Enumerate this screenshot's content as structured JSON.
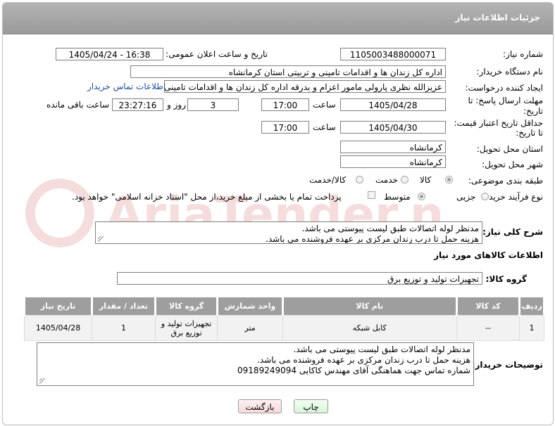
{
  "header": {
    "title": "جزئیات اطلاعات نیاز"
  },
  "form": {
    "need_number_label": "شماره نیاز:",
    "need_number": "1105003488000071",
    "announce_label": "تاریخ و ساعت اعلان عمومی:",
    "announce_value": "1405/04/24 - 16:38",
    "buyer_org_label": "نام دستگاه خریدار:",
    "buyer_org": "اداره کل زندان ها و اقدامات تامینی و تربیتی استان کرمانشاه",
    "requester_label": "ایجاد کننده درخواست:",
    "requester": "عزیزالله نظری پارولی مامور اعزام و بدرقه اداره کل زندان ها و اقدامات تامینی و تربیتی استان کرمانشاه",
    "contact_link": "اطلاعات تماس خریدار",
    "deadline_label": "مهلت ارسال پاسخ: تا تاریخ:",
    "deadline_label_1": "مهلت ارسال پاسخ: تا",
    "deadline_label_2": "تاریخ:",
    "deadline_date": "1405/04/28",
    "time_label": "ساعت",
    "deadline_time": "17:00",
    "days_value": "3",
    "days_label": "روز و",
    "remaining_time": "23:27:16",
    "remaining_label": "ساعت باقی مانده",
    "validity_label_1": "حداقل تاریخ اعتبار قیمت:",
    "validity_label_2": "تا تاریخ:",
    "validity_date": "1405/04/30",
    "validity_time": "17:00",
    "province_label": "استان محل تحویل:",
    "province": "کرمانشاه",
    "city_label": "شهر محل تحویل:",
    "city": "کرمانشاه",
    "category_label": "طبقه بندی موضوعی:",
    "category_options": [
      "کالا",
      "خدمت",
      "کالا/خدمت"
    ],
    "process_label": "نوع فرآیند خرید :",
    "process_options": [
      "جزیی",
      "متوسط"
    ],
    "payment_text": "پرداخت تمام یا بخشی از مبلغ خرید،از محل \"اسناد خزانه اسلامی\" خواهد بود."
  },
  "summary": {
    "label": "شرح کلی نیاز:",
    "lines": [
      "مدنظر لوله اتصالات طبق لیست پیوستی  می باشد.",
      "هزینه حمل تا درب زندان مرکزی بر عهده فروشنده می باشد."
    ]
  },
  "goods": {
    "section_title": "اطلاعات کالاهای مورد نیاز",
    "group_label": "گروه کالا:",
    "group_value": "تجهیزات تولید و توزیع برق"
  },
  "table": {
    "headers": [
      "ردیف",
      "کد کالا",
      "نام کالا",
      "واحد شمارش",
      "گروه کالا",
      "تعداد / مقدار",
      "تاریخ نیاز"
    ],
    "rows": [
      {
        "row": "1",
        "code": "--",
        "name": "کابل شبکه",
        "unit": "متر",
        "group_1": "تجهیزات تولید و",
        "group_2": "توزیع برق",
        "qty": "1",
        "date": "1405/04/28"
      }
    ]
  },
  "buyer_notes": {
    "label": "توضیحات خریدار:",
    "lines": [
      "مدنظر لوله اتصالات طبق لیست پیوستی  می باشد.",
      "هزینه حمل تا درب زندان مرکزی بر عهده فروشنده می باشد.",
      "شماره تماس جهت هماهنگی آقای مهندس کاکایی 09189249094"
    ]
  },
  "buttons": {
    "print": "چاپ",
    "back": "بازگشت"
  },
  "watermark": {
    "text": "AriaTender.neT"
  }
}
